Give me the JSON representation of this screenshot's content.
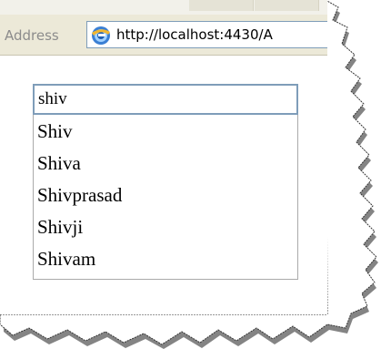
{
  "browser": {
    "address_label": "Address",
    "url": "http://localhost:4430/A",
    "page_icon": "internet-explorer-icon"
  },
  "autocomplete": {
    "input_value": "shiv",
    "suggestions": [
      "Shiv",
      "Shiva",
      "Shivprasad",
      "Shivji",
      "Shivam"
    ]
  },
  "colors": {
    "toolbar_bg": "#ece9d8",
    "input_border": "#7f9db9",
    "page_bg": "#ffffff"
  }
}
